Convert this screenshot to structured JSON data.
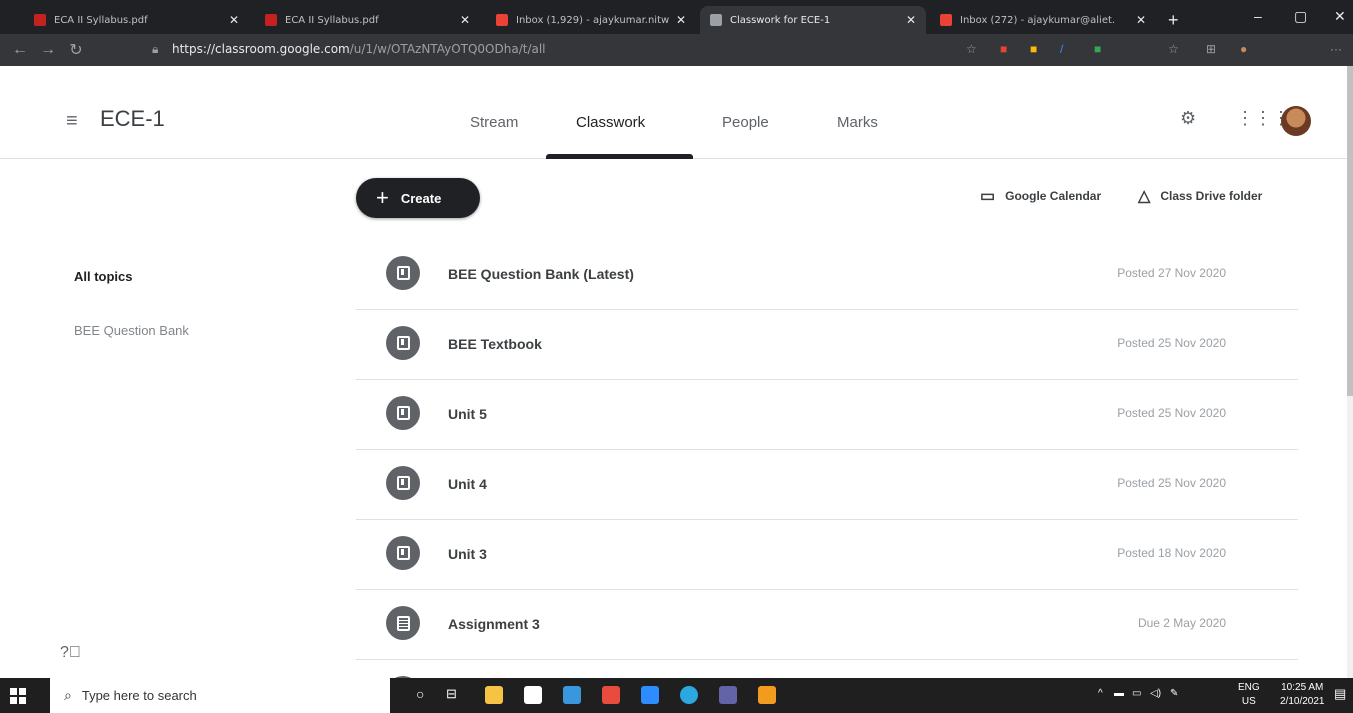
{
  "browser": {
    "tabs": [
      {
        "title": "ECA II Syllabus.pdf",
        "active": false
      },
      {
        "title": "ECA II Syllabus.pdf",
        "active": false
      },
      {
        "title": "Inbox (1,929) - ajaykumar.nitw",
        "active": false
      },
      {
        "title": "Classwork for ECE-1",
        "active": true
      },
      {
        "title": "Inbox (272) - ajaykumar@aliet.",
        "active": false
      }
    ],
    "url_host": "https://classroom.google.com",
    "url_path": "/u/1/w/OTAzNTAyOTQ0ODha/t/all"
  },
  "header": {
    "class_name": "ECE-1",
    "tabs": [
      "Stream",
      "Classwork",
      "People",
      "Marks"
    ]
  },
  "toolbar": {
    "create_label": "Create",
    "calendar_label": "Google Calendar",
    "drive_label": "Class Drive folder"
  },
  "topics": [
    "All topics",
    "BEE Question Bank"
  ],
  "items": [
    {
      "title": "BEE Question Bank (Latest)",
      "status": "Posted 27 Nov 2020",
      "icon": "material"
    },
    {
      "title": "BEE Textbook",
      "status": "Posted 25 Nov 2020",
      "icon": "material"
    },
    {
      "title": "Unit 5",
      "status": "Posted 25 Nov 2020",
      "icon": "material"
    },
    {
      "title": "Unit 4",
      "status": "Posted 25 Nov 2020",
      "icon": "material"
    },
    {
      "title": "Unit 3",
      "status": "Posted 18 Nov 2020",
      "icon": "material"
    },
    {
      "title": "Assignment 3",
      "status": "Due 2 May 2020",
      "icon": "assignment"
    }
  ],
  "taskbar": {
    "search_placeholder": "Type here to search",
    "lang": "ENG",
    "region": "US",
    "time": "10:25 AM",
    "date": "2/10/2021"
  },
  "colors": {
    "chrome_dark": "#202124",
    "create_button": "#202124",
    "item_icon": "#5f6368"
  }
}
